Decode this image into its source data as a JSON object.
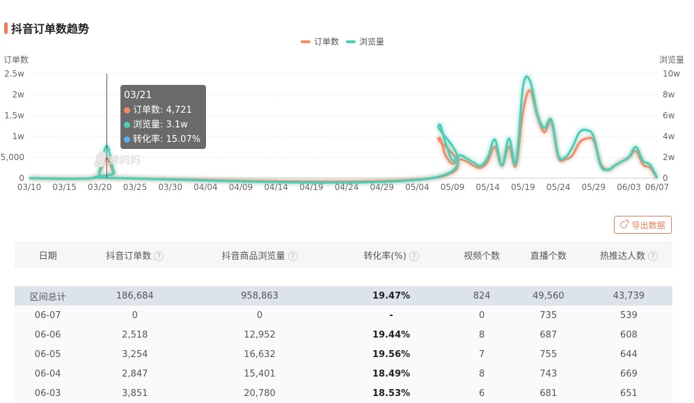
{
  "page": {
    "title": "抖音订单数趋势",
    "watermark": "蝉妈妈",
    "export_label": "导出数据",
    "help_icon": "?"
  },
  "colors": {
    "orders": "#f58a68",
    "views": "#4ecdb6",
    "rate": "#5cb0f0",
    "accent": "#f07b5a"
  },
  "chart_data": {
    "type": "line",
    "legend_position": "top-center",
    "grid": true,
    "left_axis": {
      "label": "订单数",
      "ticks": [
        "0",
        "5,000",
        "1w",
        "1.5w",
        "2w",
        "2.5w"
      ],
      "range": [
        0,
        25000
      ]
    },
    "right_axis": {
      "label": "浏览量",
      "ticks": [
        "0",
        "2w",
        "4w",
        "6w",
        "8w",
        "10w"
      ],
      "range": [
        0,
        100000
      ]
    },
    "x_ticks": [
      "03/10",
      "03/15",
      "03/20",
      "03/25",
      "03/30",
      "04/04",
      "04/09",
      "04/14",
      "04/19",
      "04/24",
      "04/29",
      "05/04",
      "05/09",
      "05/14",
      "05/19",
      "05/24",
      "05/29",
      "06/03",
      "06/07"
    ],
    "series": [
      {
        "name": "订单数",
        "axis": "left",
        "points": [
          [
            "03/10",
            0
          ],
          [
            "03/19",
            0
          ],
          [
            "03/20",
            1500
          ],
          [
            "03/21",
            4721
          ],
          [
            "03/22",
            1200
          ],
          [
            "03/23",
            0
          ],
          [
            "05/06",
            0
          ],
          [
            "05/07",
            9500
          ],
          [
            "05/08",
            5500
          ],
          [
            "05/09",
            3500
          ],
          [
            "05/10",
            4500
          ],
          [
            "05/11",
            4000
          ],
          [
            "05/12",
            3000
          ],
          [
            "05/13",
            2500
          ],
          [
            "05/14",
            4000
          ],
          [
            "05/15",
            7500
          ],
          [
            "05/16",
            3000
          ],
          [
            "05/17",
            7500
          ],
          [
            "05/18",
            3000
          ],
          [
            "05/19",
            16000
          ],
          [
            "05/20",
            21000
          ],
          [
            "05/21",
            15000
          ],
          [
            "05/22",
            11000
          ],
          [
            "05/23",
            13500
          ],
          [
            "05/24",
            5000
          ],
          [
            "05/25",
            4500
          ],
          [
            "05/26",
            5500
          ],
          [
            "05/27",
            8500
          ],
          [
            "05/28",
            9500
          ],
          [
            "05/29",
            9000
          ],
          [
            "05/30",
            3500
          ],
          [
            "05/31",
            2000
          ],
          [
            "06/01",
            3000
          ],
          [
            "06/02",
            4000
          ],
          [
            "06/03",
            5000
          ],
          [
            "06/04",
            6500
          ],
          [
            "06/05",
            3254
          ],
          [
            "06/06",
            2518
          ],
          [
            "06/07",
            0
          ]
        ]
      },
      {
        "name": "浏览量",
        "axis": "right",
        "points": [
          [
            "03/10",
            0
          ],
          [
            "03/19",
            0
          ],
          [
            "03/20",
            8000
          ],
          [
            "03/21",
            31000
          ],
          [
            "03/22",
            6000
          ],
          [
            "03/23",
            0
          ],
          [
            "05/06",
            0
          ],
          [
            "05/07",
            50000
          ],
          [
            "05/08",
            34000
          ],
          [
            "05/09",
            17000
          ],
          [
            "05/10",
            22000
          ],
          [
            "05/11",
            19000
          ],
          [
            "05/12",
            15000
          ],
          [
            "05/13",
            12000
          ],
          [
            "05/14",
            20000
          ],
          [
            "05/15",
            37000
          ],
          [
            "05/16",
            12000
          ],
          [
            "05/17",
            38000
          ],
          [
            "05/18",
            15000
          ],
          [
            "05/19",
            88000
          ],
          [
            "05/20",
            93000
          ],
          [
            "05/21",
            62000
          ],
          [
            "05/22",
            48000
          ],
          [
            "05/23",
            56000
          ],
          [
            "05/24",
            22000
          ],
          [
            "05/25",
            20000
          ],
          [
            "05/26",
            30000
          ],
          [
            "05/27",
            44000
          ],
          [
            "05/28",
            46000
          ],
          [
            "05/29",
            40000
          ],
          [
            "05/30",
            12000
          ],
          [
            "05/31",
            8000
          ],
          [
            "06/01",
            12000
          ],
          [
            "06/02",
            16000
          ],
          [
            "06/03",
            20000
          ],
          [
            "06/04",
            30000
          ],
          [
            "06/05",
            16632
          ],
          [
            "06/06",
            12952
          ],
          [
            "06/07",
            0
          ]
        ]
      }
    ],
    "tooltip": {
      "date": "03/21",
      "rows": [
        {
          "label": "订单数: 4,721",
          "color": "#f58a68"
        },
        {
          "label": "浏览量: 3.1w",
          "color": "#4ecdb6"
        },
        {
          "label": "转化率: 15.07%",
          "color": "#5cb0f0"
        }
      ]
    }
  },
  "table": {
    "headers": [
      {
        "label": "日期",
        "help": false
      },
      {
        "label": "抖音订单数",
        "help": true
      },
      {
        "label": "抖音商品浏览量",
        "help": true
      },
      {
        "label": "转化率(%)",
        "help": true
      },
      {
        "label": "视频个数",
        "help": false
      },
      {
        "label": "直播个数",
        "help": false
      },
      {
        "label": "热推达人数",
        "help": true
      }
    ],
    "total": [
      "区间总计",
      "186,684",
      "958,863",
      "19.47%",
      "824",
      "49,560",
      "43,739"
    ],
    "rows": [
      [
        "06-07",
        "0",
        "0",
        "-",
        "0",
        "735",
        "539"
      ],
      [
        "06-06",
        "2,518",
        "12,952",
        "19.44%",
        "8",
        "687",
        "608"
      ],
      [
        "06-05",
        "3,254",
        "16,632",
        "19.56%",
        "7",
        "755",
        "644"
      ],
      [
        "06-04",
        "2,847",
        "15,401",
        "18.49%",
        "8",
        "743",
        "669"
      ],
      [
        "06-03",
        "3,851",
        "20,780",
        "18.53%",
        "6",
        "681",
        "651"
      ]
    ]
  }
}
